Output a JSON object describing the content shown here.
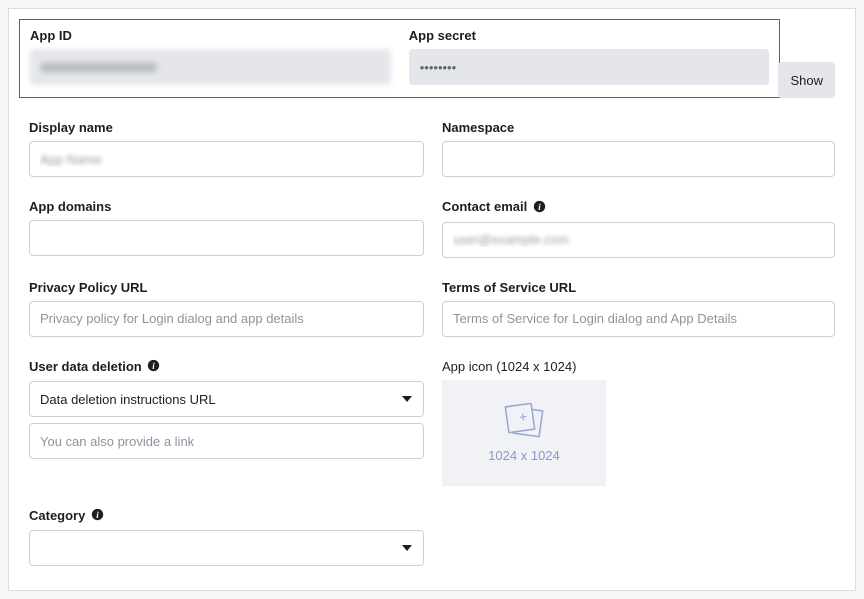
{
  "fields": {
    "appId": {
      "label": "App ID",
      "value": "0000000000000000"
    },
    "appSecret": {
      "label": "App secret",
      "value": "••••••••",
      "showLabel": "Show"
    },
    "displayName": {
      "label": "Display name",
      "value": "App Name"
    },
    "namespace": {
      "label": "Namespace",
      "value": ""
    },
    "appDomains": {
      "label": "App domains",
      "value": ""
    },
    "contactEmail": {
      "label": "Contact email",
      "value": "user@example.com"
    },
    "privacyPolicy": {
      "label": "Privacy Policy URL",
      "placeholder": "Privacy policy for Login dialog and app details"
    },
    "termsOfService": {
      "label": "Terms of Service URL",
      "placeholder": "Terms of Service for Login dialog and App Details"
    },
    "userDataDeletion": {
      "label": "User data deletion",
      "selected": "Data deletion instructions URL",
      "linkPlaceholder": "You can also provide a link"
    },
    "appIcon": {
      "label": "App icon (1024 x 1024)",
      "dimensions": "1024 x 1024"
    },
    "category": {
      "label": "Category",
      "selected": ""
    }
  }
}
